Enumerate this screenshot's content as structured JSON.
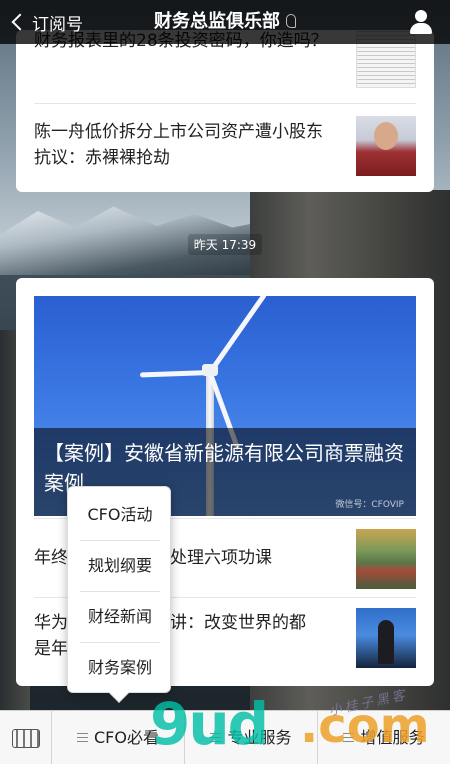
{
  "header": {
    "back_label": "订阅号",
    "title": "财务总监俱乐部"
  },
  "feed": {
    "card1": {
      "items": [
        {
          "title": "财务报表里的28条投资密码，你造吗？",
          "thumb": "newspaper-thumbnail"
        },
        {
          "title": "陈一舟低价拆分上市公司资产遭小股东抗议：赤裸裸抢劫",
          "thumb": "person-thumbnail"
        }
      ]
    },
    "timestamp": "昨天 17:39",
    "card2": {
      "hero_title": "【案例】安徽省新能源有限公司商票融资案例",
      "hero_watermark": "微信号：CFOVIP",
      "items": [
        {
          "title_visible_left": "年终",
          "title_visible_right": "处理六项功课",
          "thumb": "town-thumbnail"
        },
        {
          "title_visible_left": "华为",
          "title_visible_right": "讲：改变世界的都",
          "title_line2": "是年",
          "thumb": "speaker-thumbnail"
        }
      ]
    }
  },
  "popup_menu": {
    "items": [
      "CFO活动",
      "规划纲要",
      "财经新闻",
      "财务案例"
    ]
  },
  "bottom_bar": {
    "tabs": [
      "CFO必看",
      "专业服务",
      "增值服务"
    ]
  },
  "watermark": {
    "main": "9ud",
    "suffix": ".com",
    "handwriting": "小桂子黑客"
  },
  "colors": {
    "header_bg": "#000000",
    "accent_teal": "#00bea5",
    "accent_orange": "#eca028"
  }
}
